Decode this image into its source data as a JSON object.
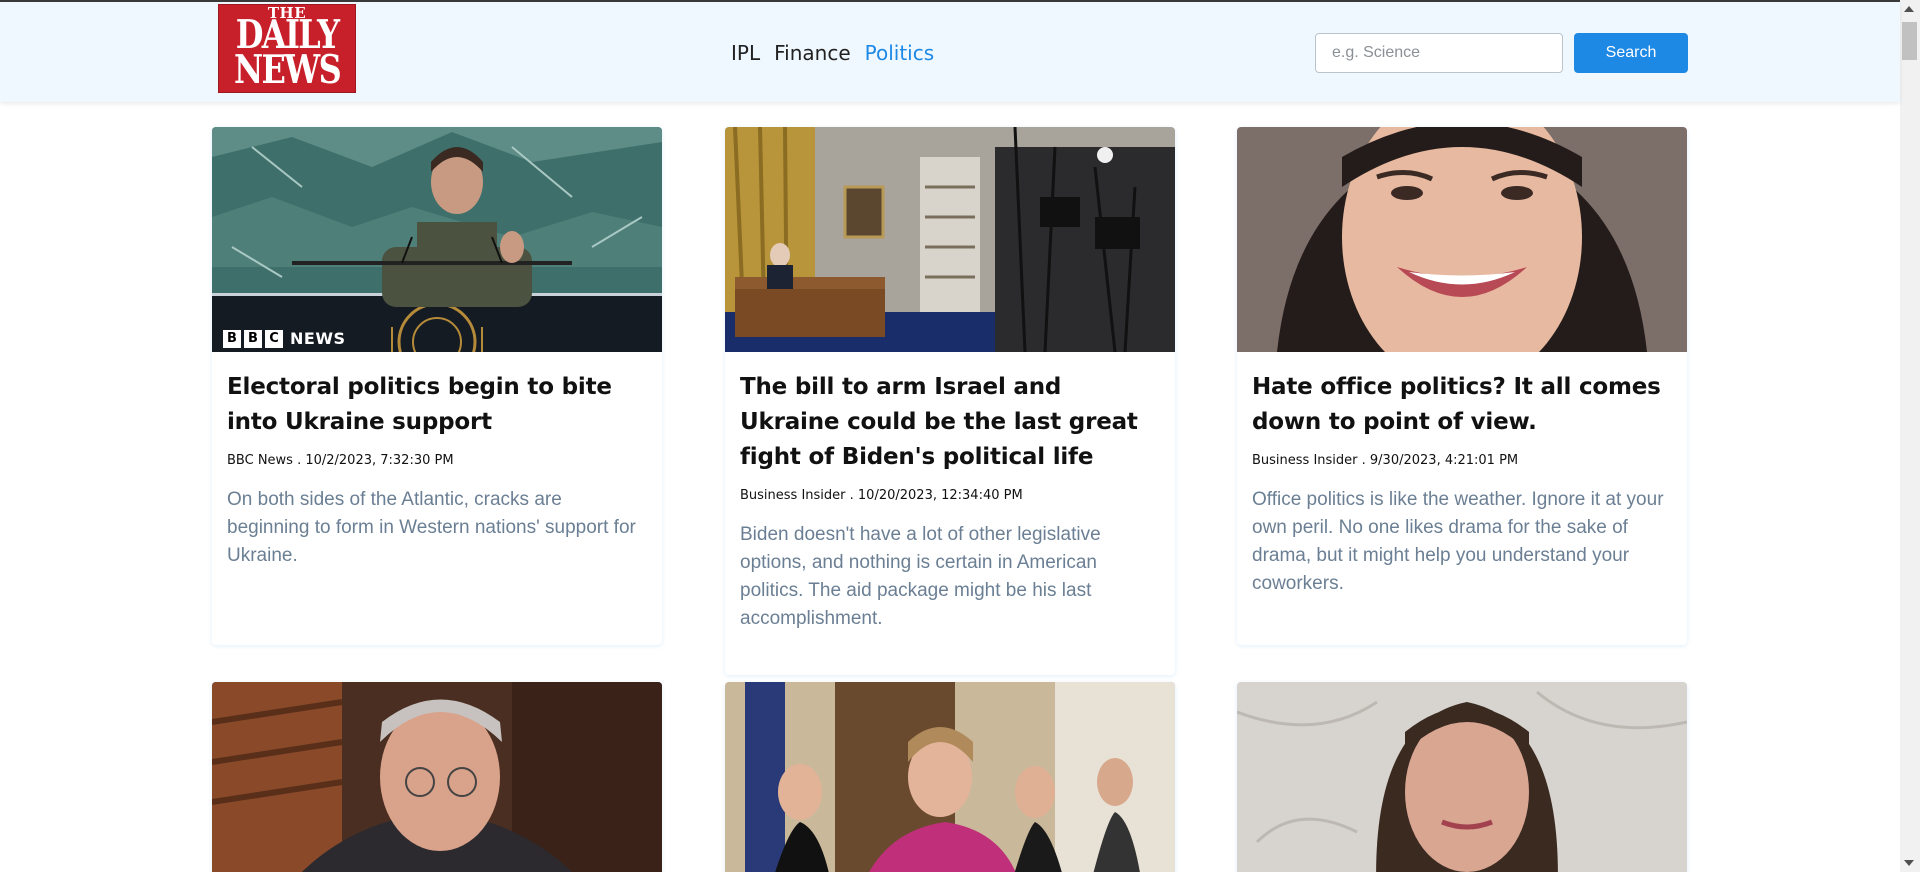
{
  "logo": {
    "line1": "THE",
    "line2": "DAILY",
    "line3": "NEWS"
  },
  "nav": {
    "items": [
      "IPL",
      "Finance",
      "Politics"
    ],
    "active": "Politics"
  },
  "search": {
    "placeholder": "e.g. Science",
    "value": "",
    "button_label": "Search"
  },
  "articles": [
    {
      "title": "Electoral politics begin to bite into Ukraine support",
      "meta": "BBC News . 10/2/2023, 7:32:30 PM",
      "description": "On both sides of the Atlantic, cracks are beginning to form in Western nations' support for Ukraine.",
      "image_overlay": {
        "boxes": [
          "B",
          "B",
          "C"
        ],
        "word": "NEWS"
      }
    },
    {
      "title": "The bill to arm Israel and Ukraine could be the last great fight of Biden's political life",
      "meta": "Business Insider . 10/20/2023, 12:34:40 PM",
      "description": "Biden doesn't have a lot of other legislative options, and nothing is certain in American politics. The aid package might be his last accomplishment."
    },
    {
      "title": "Hate office politics? It all comes down to point of view.",
      "meta": "Business Insider . 9/30/2023, 4:21:01 PM",
      "description": "Office politics is like the weather. Ignore it at your own peril. No one likes drama for the sake of drama, but it might help you understand your coworkers."
    },
    {
      "title": "",
      "meta": "",
      "description": ""
    },
    {
      "title": "",
      "meta": "",
      "description": ""
    },
    {
      "title": "",
      "meta": "",
      "description": ""
    }
  ],
  "colors": {
    "accent": "#1e88e5",
    "header_bg": "#f0f8ff",
    "description": "#6b7f94",
    "logo_red": "#c8202a"
  }
}
